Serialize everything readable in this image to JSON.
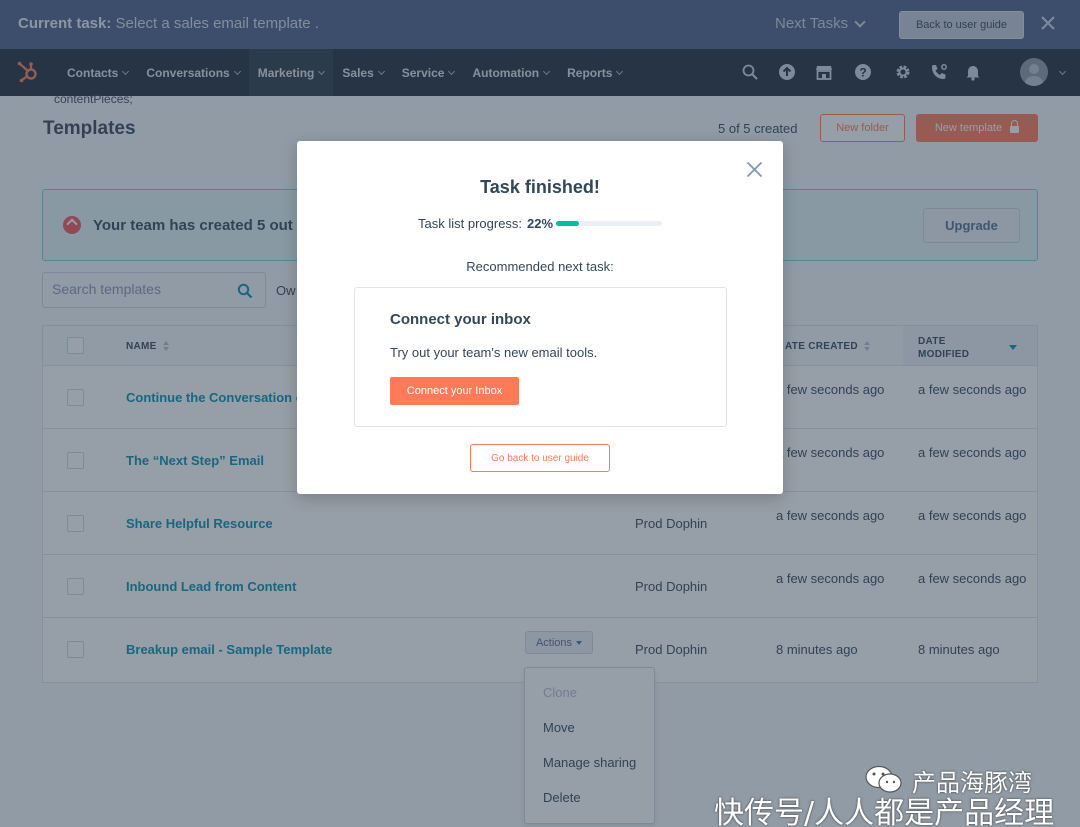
{
  "task_banner": {
    "current_label": "Current task:",
    "current_task": "Select a sales email template .",
    "next_tasks": "Next Tasks",
    "back_button": "Back to user guide"
  },
  "nav": {
    "items": [
      {
        "label": "Contacts"
      },
      {
        "label": "Conversations"
      },
      {
        "label": "Marketing"
      },
      {
        "label": "Sales"
      },
      {
        "label": "Service"
      },
      {
        "label": "Automation"
      },
      {
        "label": "Reports"
      }
    ],
    "icons": [
      "search-icon",
      "upgrade-icon",
      "marketplace-icon",
      "help-icon",
      "settings-icon",
      "calling-icon",
      "notifications-icon"
    ]
  },
  "page": {
    "breadcrumb": "contentPieces;",
    "title": "Templates",
    "count": "5 of 5 created",
    "new_folder": "New folder",
    "new_template": "New template"
  },
  "alert": {
    "text": "Your team has created 5 out",
    "upgrade": "Upgrade"
  },
  "search": {
    "placeholder": "Search templates"
  },
  "filter": {
    "owner_label": "Ow"
  },
  "table": {
    "headers": {
      "name": "NAME",
      "date_created": "ATE CREATED",
      "date_modified_line1": "DATE",
      "date_modified_line2": "MODIFIED"
    },
    "rows": [
      {
        "name": "Continue the Conversation c",
        "owner": "",
        "created": "a few seconds ago",
        "modified": "a few seconds ago"
      },
      {
        "name": "The “Next Step” Email",
        "owner": "",
        "created": "a few seconds ago",
        "modified": "a few seconds ago"
      },
      {
        "name": "Share Helpful Resource",
        "owner": "Prod Dophin",
        "created": "a few seconds ago",
        "modified": "a few seconds ago"
      },
      {
        "name": "Inbound Lead from Content",
        "owner": "Prod Dophin",
        "created": "a few seconds ago",
        "modified": "a few seconds ago"
      },
      {
        "name": "Breakup email - Sample Template",
        "owner": "Prod Dophin",
        "created": "8 minutes ago",
        "modified": "8 minutes ago"
      }
    ],
    "actions_label": "Actions"
  },
  "actions_menu": {
    "items": [
      {
        "label": "Clone",
        "disabled": true
      },
      {
        "label": "Move",
        "disabled": false
      },
      {
        "label": "Manage sharing",
        "disabled": false
      },
      {
        "label": "Delete",
        "disabled": false
      }
    ]
  },
  "modal": {
    "title": "Task finished!",
    "progress_label": "Task list progress:",
    "progress_value": "22%",
    "progress_fraction": 0.22,
    "recommended": "Recommended next task:",
    "card_title": "Connect your inbox",
    "card_text": "Try out your team's new email tools.",
    "card_button": "Connect your Inbox",
    "go_back": "Go back to user guide"
  },
  "watermark": {
    "line1": "产品海豚湾",
    "line2": "快传号/人人都是产品经理"
  },
  "colors": {
    "accent": "#ff7a59",
    "link": "#0091ae",
    "progress": "#00bda5",
    "nav_bg": "#1f2b3b",
    "banner_bg": "#4a5f86"
  }
}
